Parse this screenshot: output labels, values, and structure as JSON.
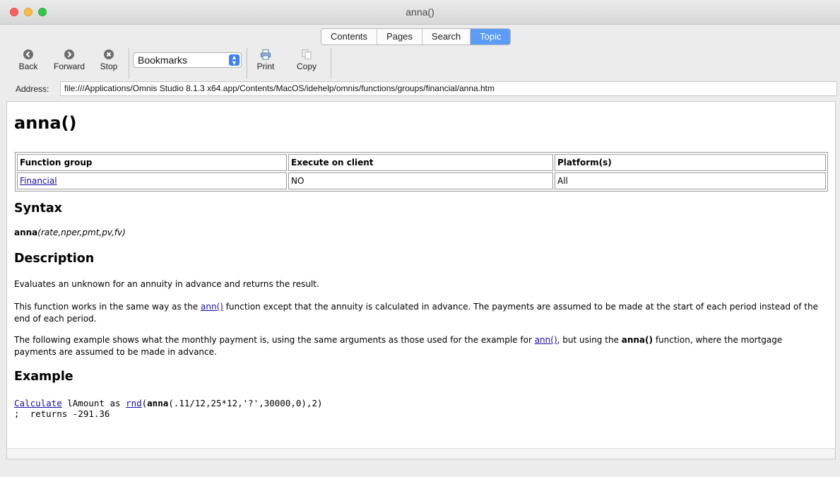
{
  "window": {
    "title": "anna()"
  },
  "tabs": [
    {
      "label": "Contents",
      "active": false
    },
    {
      "label": "Pages",
      "active": false
    },
    {
      "label": "Search",
      "active": false
    },
    {
      "label": "Topic",
      "active": true
    }
  ],
  "toolbar": {
    "back_label": "Back",
    "forward_label": "Forward",
    "stop_label": "Stop",
    "bookmarks_value": "Bookmarks",
    "print_label": "Print",
    "copy_label": "Copy"
  },
  "address": {
    "label": "Address:",
    "value": "file:///Applications/Omnis Studio 8.1.3 x64.app/Contents/MacOS/idehelp/omnis/functions/groups/financial/anna.htm"
  },
  "doc": {
    "title": "anna()",
    "table": {
      "headers": [
        "Function group",
        "Execute on client",
        "Platform(s)"
      ],
      "row": [
        "Financial",
        "NO",
        "All"
      ]
    },
    "syntax_heading": "Syntax",
    "syntax_fn": "anna",
    "syntax_args": "(rate,nper,pmt,pv,fv)",
    "description_heading": "Description",
    "desc_p1": "Evaluates an unknown for an annuity in advance and returns the result.",
    "desc_p2_a": "This function works in the same way as the ",
    "desc_p2_link": "ann()",
    "desc_p2_b": " function except that the annuity is calculated in advance. The payments are assumed to be made at the start of each period instead of the end of each period.",
    "desc_p3_a": "The following example shows what the monthly payment is, using the same arguments as those used for the example for ",
    "desc_p3_link": "ann()",
    "desc_p3_b": ", but using the ",
    "desc_p3_bold": "anna()",
    "desc_p3_c": " function, where the mortgage payments are assumed to be made in advance.",
    "example_heading": "Example",
    "code_cmd": "Calculate",
    "code_mid": " lAmount as ",
    "code_fn": "rnd",
    "code_paren": "(",
    "code_anna": "anna",
    "code_rest": "(.11/12,25*12,'?',30000,0),2)",
    "code_line2": ";  returns -291.36"
  },
  "colors": {
    "tab_active": "#5b9cf8",
    "link": "#1a0dab",
    "select_chevron": "#3b82f6"
  },
  "icons": [
    "back-icon",
    "forward-icon",
    "stop-icon",
    "print-icon",
    "copy-icon",
    "select-chevron-icon"
  ]
}
